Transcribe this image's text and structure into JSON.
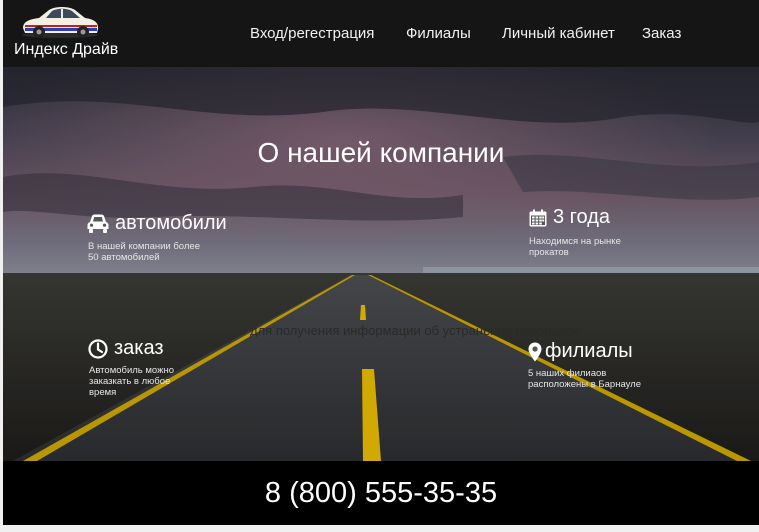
{
  "brand": {
    "name": "Индекс Драйв",
    "logo_icon": "car-logo-icon"
  },
  "nav": {
    "items": [
      {
        "label": "Вход/регестрация"
      },
      {
        "label": "Филиалы"
      },
      {
        "label": "Личный кабинет"
      },
      {
        "label": "Заказ"
      }
    ]
  },
  "hero": {
    "title": "О нашей компании",
    "features": [
      {
        "icon": "car-icon",
        "title": "автомобили",
        "desc_lines": [
          "В нашей компании более",
          "50 автомобилей"
        ]
      },
      {
        "icon": "calendar-icon",
        "title": "3 года",
        "desc_lines": [
          "Находимся на рынке",
          "прокатов"
        ]
      },
      {
        "icon": "clock-icon",
        "title": "заказ",
        "desc_lines": [
          "Автомобиль можно",
          "заказкать в любое",
          "время"
        ]
      },
      {
        "icon": "map-marker-icon",
        "title": "филиалы",
        "desc_lines": [
          "5 наших филиаов",
          "расположены в Барнауле"
        ]
      }
    ],
    "center_text": "для получения информации об устранении неполадок"
  },
  "footer": {
    "phone": "8 (800) 555-35-35"
  },
  "colors": {
    "header_bg": "#151515",
    "footer_bg": "#000000",
    "road_line": "#e3b800"
  }
}
